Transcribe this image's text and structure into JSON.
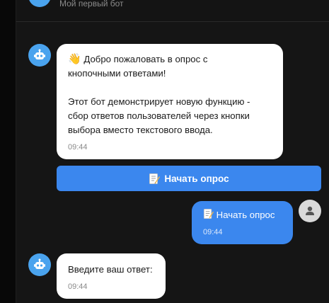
{
  "header": {
    "subtitle": "Мой первый бот"
  },
  "messages": [
    {
      "sender": "bot",
      "lines_1": [
        "Добро пожаловать в опрос с",
        "кнопочными ответами!"
      ],
      "lines_2": [
        "Этот бот демонстрирует новую функцию -",
        "сбор ответов пользователей через кнопки",
        "выбора вместо текстового ввода."
      ],
      "emoji": "👋",
      "time": "09:44"
    },
    {
      "sender": "user",
      "text": "Начать опрос",
      "icon": "memo-icon",
      "time": "09:44"
    },
    {
      "sender": "bot",
      "text": "Введите ваш ответ:",
      "time": "09:44"
    }
  ],
  "keyboard": {
    "button_label": "Начать опрос",
    "button_icon": "memo-icon"
  },
  "colors": {
    "background": "#080808",
    "chat_bg": "#151515",
    "bot_avatar": "#4aa3ee",
    "user_bubble": "#3b87ee",
    "bot_bubble": "#ffffff",
    "button": "#3b87ee"
  }
}
